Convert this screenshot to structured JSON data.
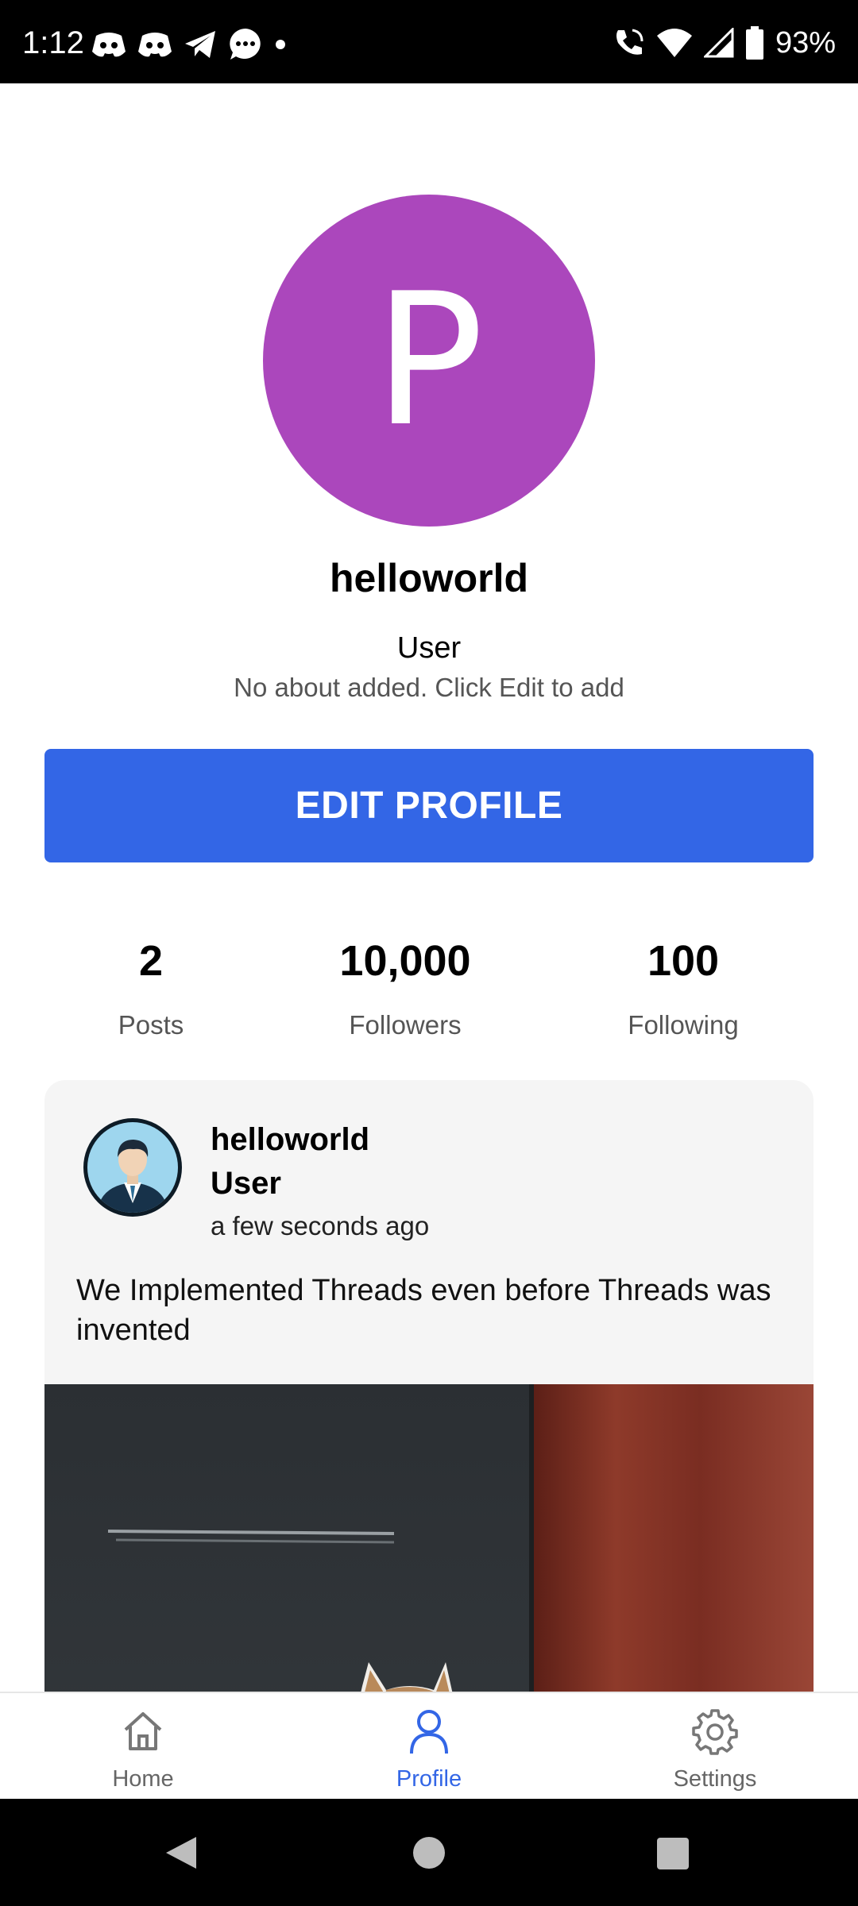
{
  "status_bar": {
    "time": "1:12",
    "battery": "93%",
    "icons": [
      "discord-icon",
      "discord-icon",
      "telegram-icon",
      "chat-bubble-icon",
      "dot-icon",
      "wifi-call-icon",
      "wifi-icon",
      "signal-icon",
      "battery-icon"
    ]
  },
  "profile": {
    "avatar_letter": "P",
    "avatar_color": "#ab47bc",
    "username": "helloworld",
    "role": "User",
    "about": "No about added. Click Edit to add"
  },
  "edit_button": {
    "label": "EDIT PROFILE",
    "color": "#3366e6"
  },
  "stats": [
    {
      "value": "2",
      "label": "Posts"
    },
    {
      "value": "10,000",
      "label": "Followers"
    },
    {
      "value": "100",
      "label": "Following"
    }
  ],
  "post": {
    "author": "helloworld",
    "role": "User",
    "time": "a few seconds ago",
    "text": "We Implemented Threads even before Threads was invented",
    "image": "cat-photo"
  },
  "bottom_nav": {
    "items": [
      {
        "label": "Home",
        "icon": "home-icon"
      },
      {
        "label": "Profile",
        "icon": "person-icon",
        "active": true
      },
      {
        "label": "Settings",
        "icon": "gear-icon"
      }
    ],
    "active_color": "#3366e6"
  }
}
